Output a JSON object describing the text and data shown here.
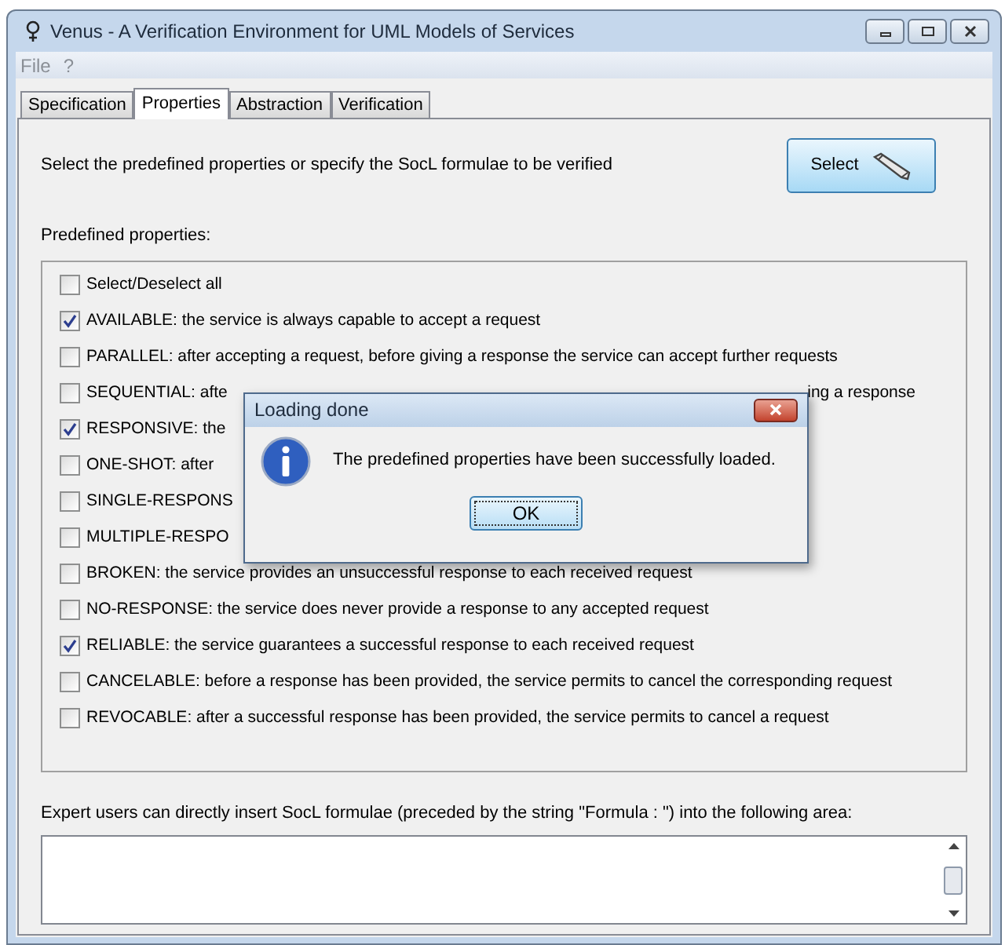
{
  "window": {
    "title": "Venus - A Verification Environment for UML Models of Services"
  },
  "menu": [
    "File",
    "?"
  ],
  "tabs": [
    {
      "label": "Specification",
      "selected": false
    },
    {
      "label": "Properties",
      "selected": true
    },
    {
      "label": "Abstraction",
      "selected": false
    },
    {
      "label": "Verification",
      "selected": false
    }
  ],
  "instruction": "Select the predefined properties or specify the SocL formulae to be verified",
  "select_button": "Select",
  "predefined_label": "Predefined properties:",
  "properties": [
    {
      "label": "Select/Deselect all",
      "checked": false
    },
    {
      "label": "AVAILABLE: the service is always capable to accept a request",
      "checked": true
    },
    {
      "label": "PARALLEL: after accepting a request, before giving a response the service can accept further requests",
      "checked": false
    },
    {
      "label": "SEQUENTIAL: afte",
      "suffix": "ing a response",
      "checked": false
    },
    {
      "label": "RESPONSIVE: the",
      "checked": true
    },
    {
      "label": "ONE-SHOT: after",
      "checked": false
    },
    {
      "label": "SINGLE-RESPONS",
      "checked": false
    },
    {
      "label": "MULTIPLE-RESPO",
      "checked": false
    },
    {
      "label": "BROKEN: the service provides an unsuccessful response to each received request",
      "checked": false
    },
    {
      "label": "NO-RESPONSE: the service does never provide a response to any accepted request",
      "checked": false
    },
    {
      "label": "RELIABLE: the service guarantees a successful response to each received request",
      "checked": true
    },
    {
      "label": "CANCELABLE: before a response has been provided, the service permits to cancel the corresponding request",
      "checked": false
    },
    {
      "label": "REVOCABLE: after a successful response has been provided, the service permits to cancel a request",
      "checked": false
    }
  ],
  "expert_label": "Expert users can directly insert SocL formulae (preceded by the string \"Formula : \") into the following area:",
  "dialog": {
    "title": "Loading done",
    "message": "The predefined properties have been successfully loaded.",
    "button": "OK"
  }
}
